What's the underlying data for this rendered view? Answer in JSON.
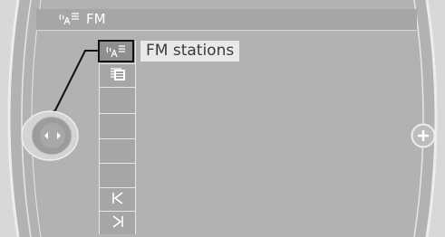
{
  "header": {
    "title": "FM",
    "icon": "radio-broadcast-icon"
  },
  "menu": {
    "selected_label": "FM stations",
    "items": [
      {
        "icon": "radio-broadcast-icon"
      },
      {
        "icon": "station-list-icon"
      },
      {
        "icon": ""
      },
      {
        "icon": ""
      },
      {
        "icon": ""
      },
      {
        "icon": "previous-track-icon"
      },
      {
        "icon": "next-track-icon"
      }
    ]
  },
  "controller": {
    "icon": "idrive-controller-icon"
  },
  "right_button": {
    "icon": "plus-icon"
  }
}
